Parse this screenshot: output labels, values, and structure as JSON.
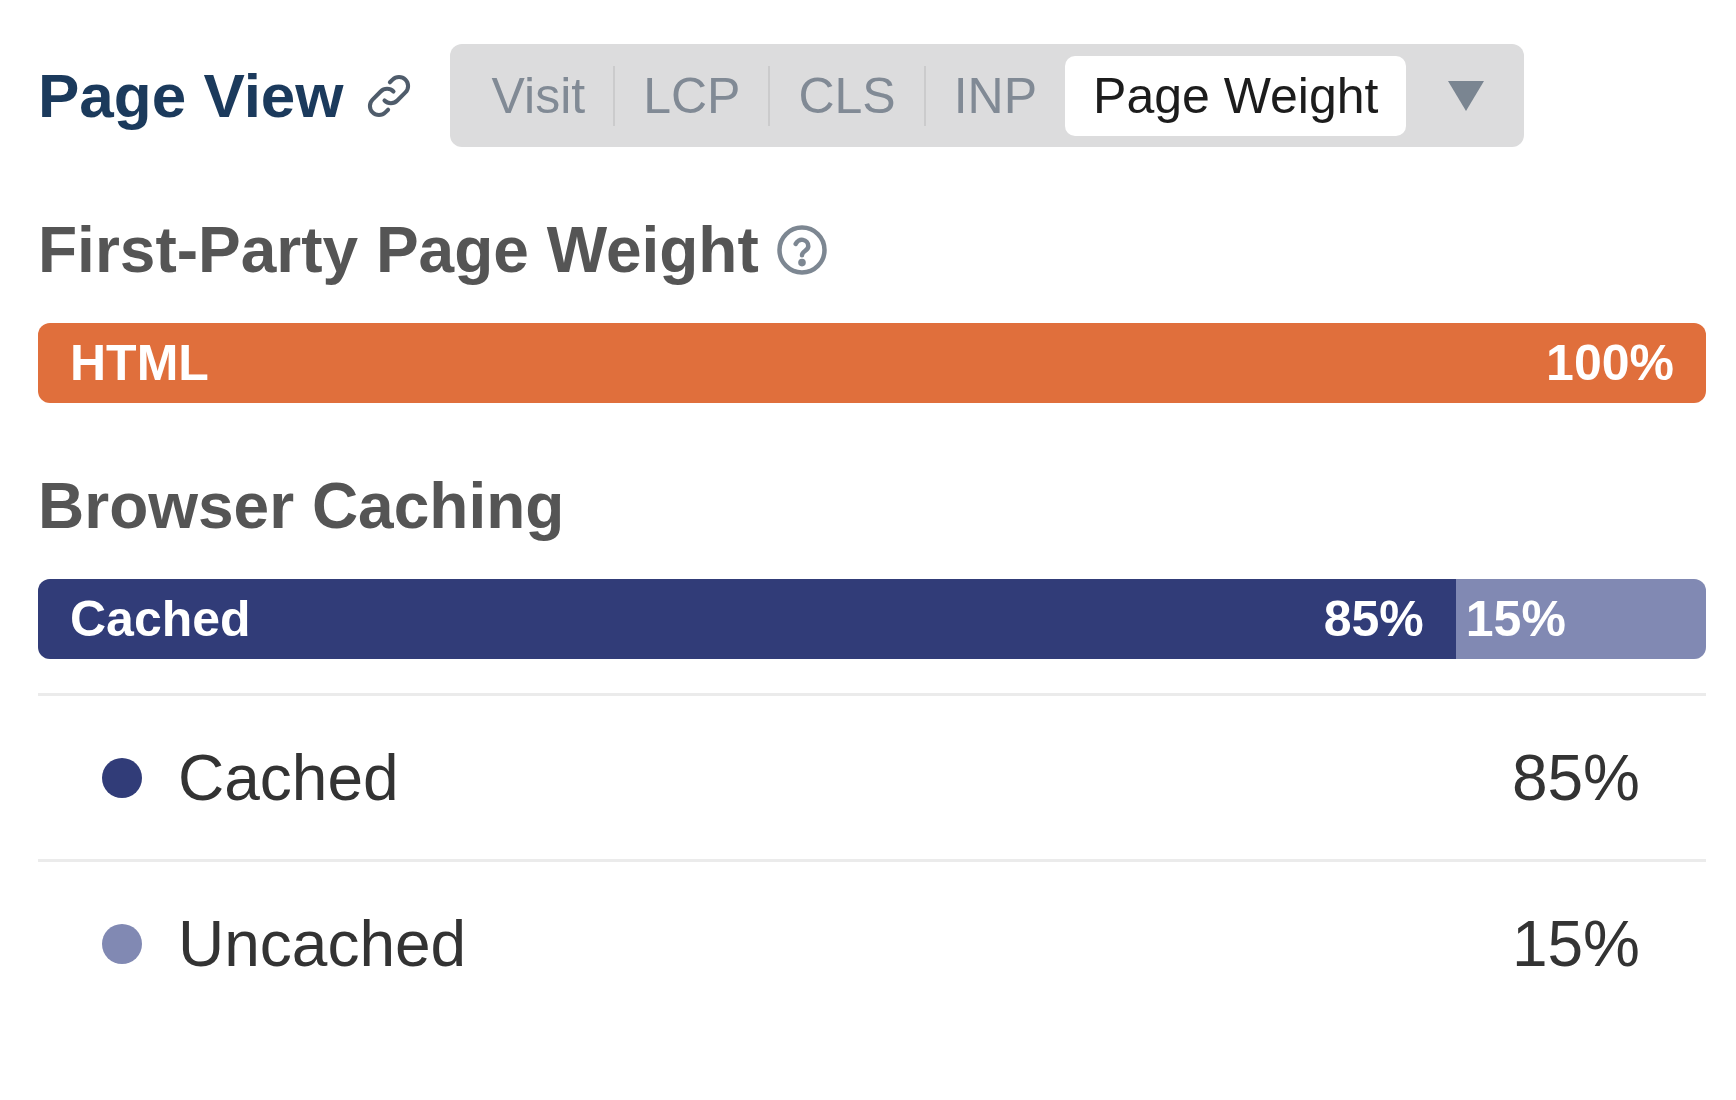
{
  "header": {
    "title": "Page View",
    "tabs": [
      {
        "label": "Visit",
        "selected": false
      },
      {
        "label": "LCP",
        "selected": false
      },
      {
        "label": "CLS",
        "selected": false
      },
      {
        "label": "INP",
        "selected": false
      },
      {
        "label": "Page Weight",
        "selected": true
      }
    ]
  },
  "first_party": {
    "title": "First-Party Page Weight",
    "segments": [
      {
        "label": "HTML",
        "value": "100%",
        "color": "#e06f3c"
      }
    ]
  },
  "caching": {
    "title": "Browser Caching",
    "segments": [
      {
        "label": "Cached",
        "value": "85%",
        "level": 0.85,
        "color": "#313c78"
      },
      {
        "value": "15%",
        "level": 0.15,
        "color": "#8189b3"
      }
    ],
    "legend": [
      {
        "label": "Cached",
        "value": "85%",
        "color": "#313c78"
      },
      {
        "label": "Uncached",
        "value": "15%",
        "color": "#8189b3"
      }
    ]
  }
}
